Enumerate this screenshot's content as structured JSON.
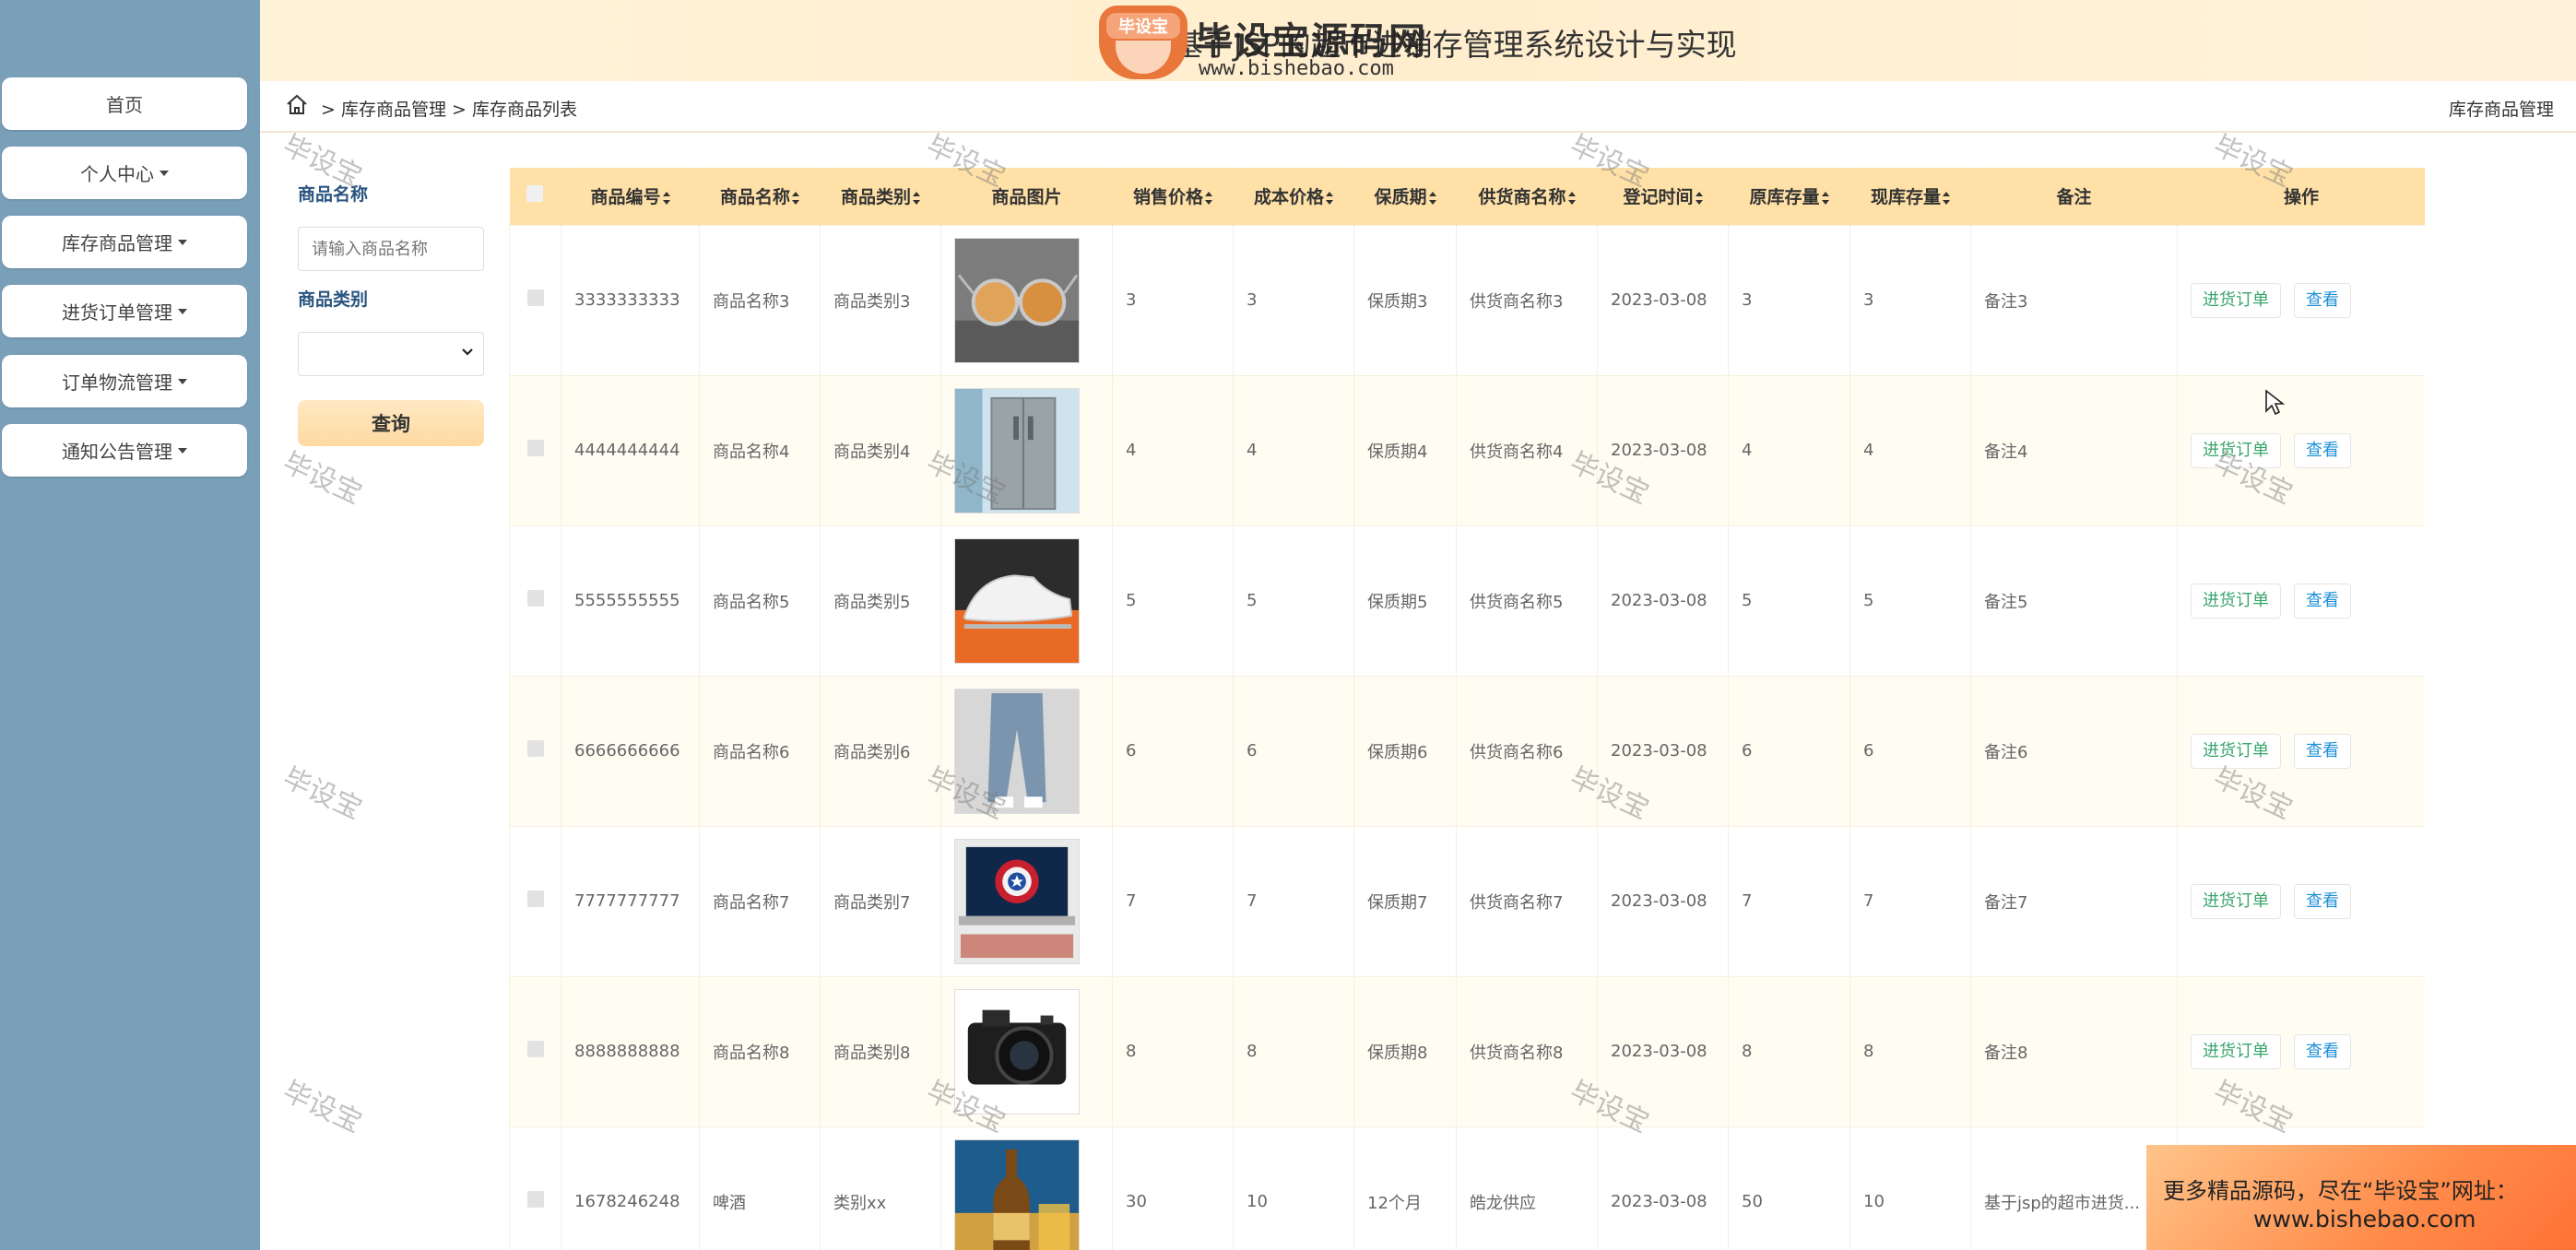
{
  "header": {
    "site_title": "基于JSP的超市进销存管理系统设计与实现",
    "logo_badge": "毕设宝",
    "logo_name": "毕设宝源码网",
    "logo_url": "www.bishebao.com"
  },
  "sidebar": {
    "items": [
      {
        "label": "首页",
        "has_caret": false
      },
      {
        "label": "个人中心",
        "has_caret": true
      },
      {
        "label": "库存商品管理",
        "has_caret": true
      },
      {
        "label": "进货订单管理",
        "has_caret": true
      },
      {
        "label": "订单物流管理",
        "has_caret": true
      },
      {
        "label": "通知公告管理",
        "has_caret": true
      }
    ]
  },
  "breadcrumb": {
    "path": "> 库存商品管理 > 库存商品列表",
    "right": "库存商品管理"
  },
  "search": {
    "name_label": "商品名称",
    "name_placeholder": "请输入商品名称",
    "category_label": "商品类别",
    "category_value": "",
    "query_button": "查询"
  },
  "table": {
    "headers": [
      "",
      "商品编号",
      "商品名称",
      "商品类别",
      "商品图片",
      "销售价格",
      "成本价格",
      "保质期",
      "供货商名称",
      "登记时间",
      "原库存量",
      "现库存量",
      "备注",
      "操作"
    ],
    "rows": [
      {
        "code": "3333333333",
        "name": "商品名称3",
        "category": "商品类别3",
        "image": "sunglasses",
        "sale": "3",
        "cost": "3",
        "shelf": "保质期3",
        "supplier": "供货商名称3",
        "date": "2023-03-08",
        "orig": "3",
        "cur": "3",
        "remark": "备注3"
      },
      {
        "code": "4444444444",
        "name": "商品名称4",
        "category": "商品类别4",
        "image": "refrigerator",
        "sale": "4",
        "cost": "4",
        "shelf": "保质期4",
        "supplier": "供货商名称4",
        "date": "2023-03-08",
        "orig": "4",
        "cur": "4",
        "remark": "备注4"
      },
      {
        "code": "5555555555",
        "name": "商品名称5",
        "category": "商品类别5",
        "image": "sneaker",
        "sale": "5",
        "cost": "5",
        "shelf": "保质期5",
        "supplier": "供货商名称5",
        "date": "2023-03-08",
        "orig": "5",
        "cur": "5",
        "remark": "备注5"
      },
      {
        "code": "6666666666",
        "name": "商品名称6",
        "category": "商品类别6",
        "image": "jeans",
        "sale": "6",
        "cost": "6",
        "shelf": "保质期6",
        "supplier": "供货商名称6",
        "date": "2023-03-08",
        "orig": "6",
        "cur": "6",
        "remark": "备注6"
      },
      {
        "code": "7777777777",
        "name": "商品名称7",
        "category": "商品类别7",
        "image": "laptop",
        "sale": "7",
        "cost": "7",
        "shelf": "保质期7",
        "supplier": "供货商名称7",
        "date": "2023-03-08",
        "orig": "7",
        "cur": "7",
        "remark": "备注7"
      },
      {
        "code": "8888888888",
        "name": "商品名称8",
        "category": "商品类别8",
        "image": "camera",
        "sale": "8",
        "cost": "8",
        "shelf": "保质期8",
        "supplier": "供货商名称8",
        "date": "2023-03-08",
        "orig": "8",
        "cur": "8",
        "remark": "备注8"
      },
      {
        "code": "1678246248",
        "name": "啤酒",
        "category": "类别xx",
        "image": "beer",
        "sale": "30",
        "cost": "10",
        "shelf": "12个月",
        "supplier": "皓龙供应",
        "date": "2023-03-08",
        "orig": "50",
        "cur": "10",
        "remark": "基于jsp的超市进货..."
      }
    ],
    "op_order": "进货订单",
    "op_view": "查看"
  },
  "watermark": "毕设宝",
  "ad": {
    "line1": "更多精品源码，尽在“毕设宝”网址：",
    "line2": "www.bishebao.com"
  },
  "colors": {
    "sidebar_bg": "#7a9fb8",
    "header_bg": "#ffeecd",
    "table_header_bg": "#ffe1a8",
    "order_btn": "#3aa56b",
    "view_btn": "#1e90d8",
    "ad_bg": "#ff8c4a"
  }
}
